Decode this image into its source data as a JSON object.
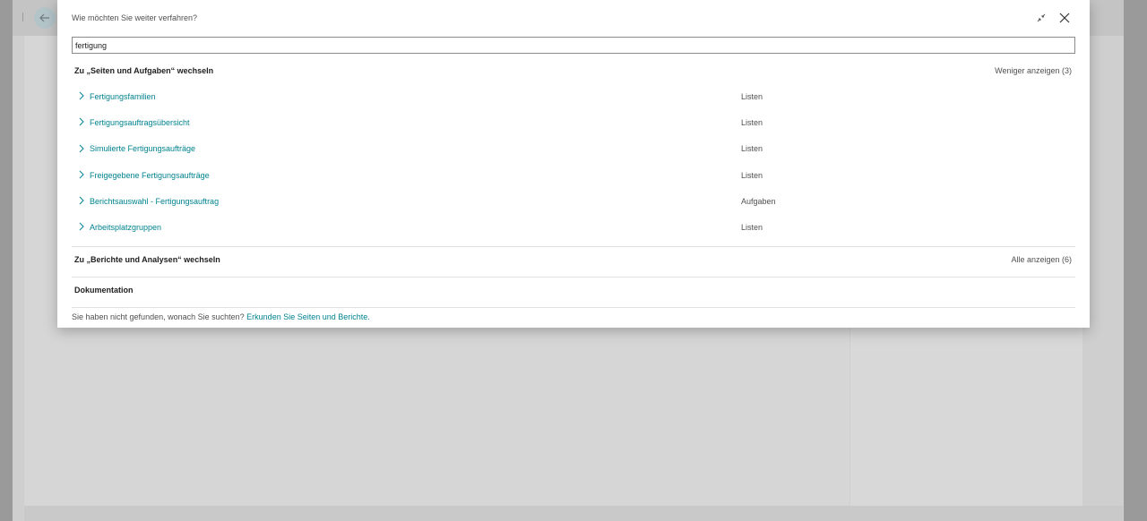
{
  "dialog": {
    "title": "Wie möchten Sie weiter verfahren?",
    "collapse_icon": "collapse-arrows-icon",
    "close_icon": "close-icon"
  },
  "search": {
    "value": "fertigung"
  },
  "pages_section": {
    "title": "Zu „Seiten und Aufgaben“ wechseln",
    "toggle_label": "Weniger anzeigen (3)",
    "items": [
      {
        "label": "Fertigungsfamilien",
        "kind": "Listen"
      },
      {
        "label": "Fertigungsauftragsübersicht",
        "kind": "Listen"
      },
      {
        "label": "Simulierte Fertigungsaufträge",
        "kind": "Listen"
      },
      {
        "label": "Freigegebene Fertigungsaufträge",
        "kind": "Listen"
      },
      {
        "label": "Berichtsauswahl - Fertigungsauftrag",
        "kind": "Aufgaben"
      },
      {
        "label": "Arbeitsplatzgruppen",
        "kind": "Listen"
      }
    ]
  },
  "reports_section": {
    "title": "Zu „Berichte und Analysen“ wechseln",
    "toggle_label": "Alle anzeigen (6)"
  },
  "docs_section": {
    "title": "Dokumentation"
  },
  "footer": {
    "text": "Sie haben nicht gefunden, wonach Sie suchten?",
    "link": "Erkunden Sie Seiten und Berichte."
  },
  "colors": {
    "accent": "#00838f",
    "overlay": "#9a9a9a"
  }
}
